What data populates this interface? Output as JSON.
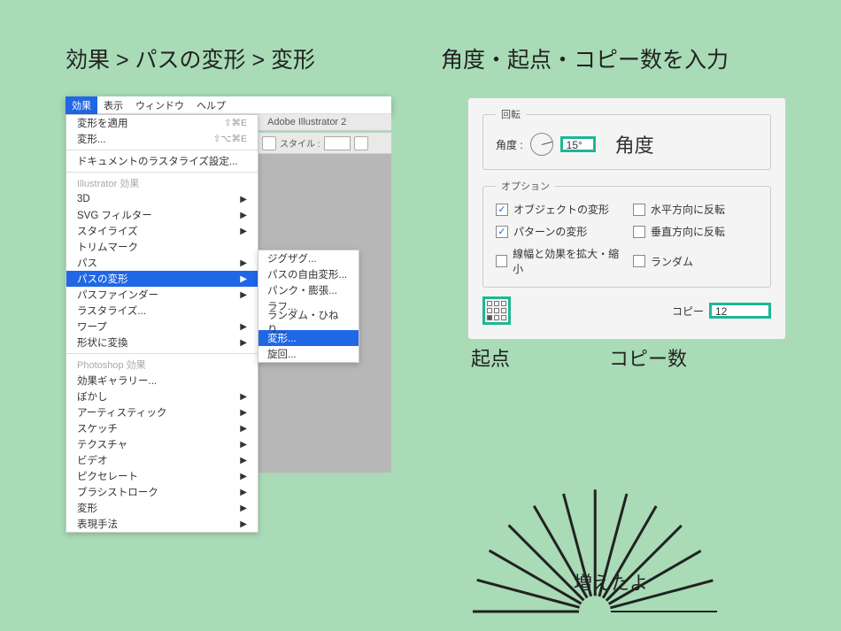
{
  "headings": {
    "left": "効果 > パスの変形 > 変形",
    "right": "角度・起点・コピー数を入力"
  },
  "menubar": {
    "items": [
      "効果",
      "表示",
      "ウィンドウ",
      "ヘルプ"
    ],
    "selected": "効果"
  },
  "titlebar": "Adobe Illustrator 2",
  "toolbar2_label": "スタイル :",
  "effects_menu": {
    "apply": {
      "label": "変形を適用",
      "shortcut": "⇧⌘E"
    },
    "transform": {
      "label": "変形...",
      "shortcut": "⇧⌥⌘E"
    },
    "rasterize_settings": "ドキュメントのラスタライズ設定...",
    "group_illustrator": "Illustrator 効果",
    "three_d": "3D",
    "svg_filter": "SVG フィルター",
    "stylize": "スタイライズ",
    "trim_marks": "トリムマーク",
    "path": "パス",
    "distort": "パスの変形",
    "pathfinder": "パスファインダー",
    "rasterize": "ラスタライズ...",
    "warp": "ワープ",
    "convert_shape": "形状に変換",
    "group_photoshop": "Photoshop 効果",
    "gallery": "効果ギャラリー...",
    "blur": "ぼかし",
    "artistic": "アーティスティック",
    "sketch": "スケッチ",
    "texture": "テクスチャ",
    "video": "ビデオ",
    "pixelate": "ピクセレート",
    "brush": "ブラシストローク",
    "distort2": "変形",
    "artistic2": "表現手法"
  },
  "submenu": {
    "zigzag": "ジグザグ...",
    "free": "パスの自由変形...",
    "pucker": "パンク・膨張...",
    "roughen": "ラフ...",
    "twist": "ランダム・ひねり...",
    "transform": "変形...",
    "rotate": "旋回..."
  },
  "dialog": {
    "rotation_legend": "回転",
    "angle_label": "角度 :",
    "angle_value": "15°",
    "angle_big_label": "角度",
    "options_legend": "オプション",
    "opt_transform_obj": "オブジェクトの変形",
    "opt_reflect_h": "水平方向に反転",
    "opt_transform_pat": "パターンの変形",
    "opt_reflect_v": "垂直方向に反転",
    "opt_scale_stroke": "線幅と効果を拡大・縮小",
    "opt_random": "ランダム",
    "copy_label": "コピー",
    "copy_value": "12"
  },
  "sublabels": {
    "origin": "起点",
    "copies": "コピー数"
  },
  "radial_label": "増えたよ"
}
